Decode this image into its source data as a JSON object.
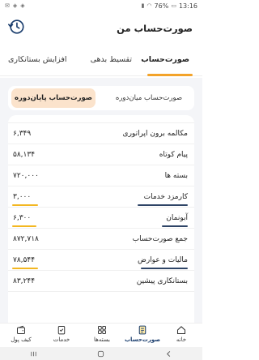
{
  "status_bar": {
    "time": "13:16",
    "battery": "76%"
  },
  "header": {
    "title": "صورت‌حساب من"
  },
  "tabs": [
    {
      "label": "صورت‌حساب",
      "active": true
    },
    {
      "label": "تقسیط بدهی",
      "active": false
    },
    {
      "label": "افزایش بستانکاری",
      "active": false
    }
  ],
  "toggle": {
    "options": [
      {
        "label": "صورت‌حساب پایان‌دوره",
        "selected": true
      },
      {
        "label": "صورت‌حساب میان‌دوره",
        "selected": false
      }
    ]
  },
  "rows": [
    {
      "label": "",
      "value": ""
    },
    {
      "label": "مکالمه برون اپراتوری",
      "value": "۶,۳۴۹"
    },
    {
      "label": "پیام کوتاه",
      "value": "۵۸,۱۳۴"
    },
    {
      "label": "بسته ها",
      "value": "۷۲۰,۰۰۰"
    },
    {
      "label": "کارمزد خدمات",
      "value": "۳,۰۰۰"
    },
    {
      "label": "آبونمان",
      "value": "۶,۳۰۰"
    },
    {
      "label": "جمع صورت‌حساب",
      "value": "۸۷۲,۷۱۸"
    },
    {
      "label": "مالیات و عوارض",
      "value": "۷۸,۵۴۴"
    },
    {
      "label": "بستانکاری پیشین",
      "value": "۸۳,۲۴۴"
    }
  ],
  "bottom_nav": [
    {
      "label": "خانه",
      "icon": "home-icon"
    },
    {
      "label": "صورت‌حساب",
      "icon": "invoice-icon",
      "active": true
    },
    {
      "label": "بسته‌ها",
      "icon": "grid-icon"
    },
    {
      "label": "خدمات",
      "icon": "checklist-icon"
    },
    {
      "label": "کیف پول",
      "icon": "wallet-icon"
    }
  ],
  "colors": {
    "accent": "#f3a32a",
    "primary": "#1b3e6e",
    "bar_yellow": "#f3b721",
    "bar_navy": "#2e4466",
    "toggle_selected": "#fbe3cc"
  }
}
